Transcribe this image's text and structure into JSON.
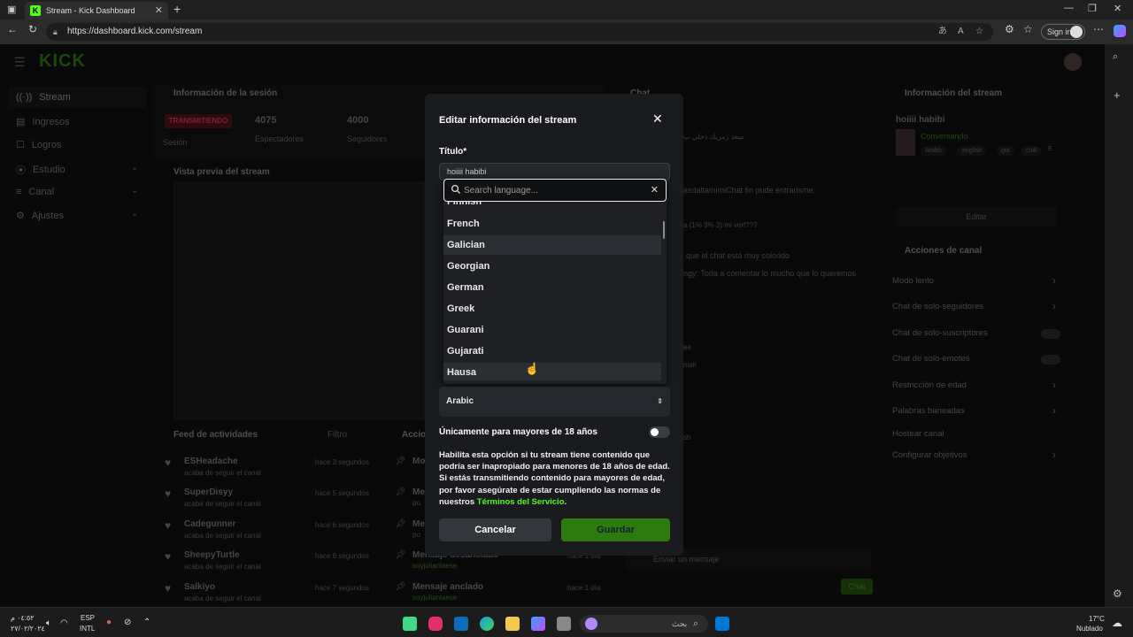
{
  "browser": {
    "tab_title": "Stream - Kick Dashboard",
    "url": "https://dashboard.kick.com/stream",
    "sign_in": "Sign in"
  },
  "sidebar": {
    "logo": "KICK",
    "items": [
      {
        "label": "Stream",
        "icon": "broadcast-icon"
      },
      {
        "label": "Ingresos",
        "icon": "wallet-icon"
      },
      {
        "label": "Logros",
        "icon": "trophy-icon"
      },
      {
        "label": "Estudio",
        "icon": "studio-icon"
      },
      {
        "label": "Canal",
        "icon": "channel-icon"
      },
      {
        "label": "Ajustes",
        "icon": "gear-icon"
      }
    ]
  },
  "session": {
    "title": "Información de la sesión",
    "status_badge": "TRANSMITIENDO",
    "status_label": "Sesión",
    "viewers": "4075",
    "viewers_label": "Espectadores",
    "followers": "4000",
    "followers_label": "Seguidores"
  },
  "preview": {
    "title": "Vista previa del stream"
  },
  "activity": {
    "title": "Feed de actividades",
    "filter": "Filtro",
    "items": [
      {
        "name": "ESHeadache",
        "sub": "acaba de seguir el canal",
        "time": "hace 3 segundos"
      },
      {
        "name": "SuperDisyy",
        "sub": "acaba de seguir el canal",
        "time": "hace 5 segundos"
      },
      {
        "name": "Cadegunner",
        "sub": "acaba de seguir el canal",
        "time": "hace 6 segundos"
      },
      {
        "name": "SheepyTurtle",
        "sub": "acaba de seguir el canal",
        "time": "hace 6 segundos"
      },
      {
        "name": "Salkiyo",
        "sub": "acaba de seguir el canal",
        "time": "hace 7 segundos"
      }
    ]
  },
  "actions_mini": {
    "title": "Accio",
    "items": [
      {
        "name": "Mo",
        "sub": ""
      },
      {
        "name": "Me",
        "sub": "po"
      },
      {
        "name": "Me",
        "sub": "po"
      },
      {
        "name": "Mensaje desanclado",
        "sub": "soyjulianlaese",
        "time": "hace 1 día"
      },
      {
        "name": "Mensaje anclado",
        "sub": "soyjulianlaese",
        "time": "hace 1 día"
      }
    ]
  },
  "chat": {
    "title": "Chat",
    "lines": [
      "سعد زمزبك دخلي ب",
      "asdaltamimiChat fin pude entrarisme:",
      "a (1% 3% 3) mi verf???",
      "que el chat está muy colorido",
      "ngy: Toda a comentar lo mucho que lo queremos",
      "nish",
      "ee",
      "sh"
    ],
    "placeholder": "Enviar un mensaje",
    "send": "Chat"
  },
  "stream_info": {
    "title": "Información del stream",
    "stream_title": "hoiiii habibi",
    "category": "Conversando",
    "tags": [
      "Arabic",
      "english",
      "gta",
      "chill",
      "E"
    ],
    "edit": "Editar"
  },
  "channel_actions": {
    "title": "Acciones de canal",
    "items": [
      {
        "label": "Modo lento",
        "control": "chevron"
      },
      {
        "label": "Chat de solo-seguidores",
        "control": "chevron"
      },
      {
        "label": "Chat de solo-suscriptores",
        "control": "toggle"
      },
      {
        "label": "Chat de solo-emotes",
        "control": "toggle"
      },
      {
        "label": "Restricción de edad",
        "control": "chevron"
      },
      {
        "label": "Palabras baneadas",
        "control": "chevron"
      },
      {
        "label": "Hostear canal",
        "control": "none"
      },
      {
        "label": "Configurar objetivos",
        "control": "chevron"
      }
    ]
  },
  "modal": {
    "title": "Editar información del stream",
    "titulo_label": "Título*",
    "titulo_value": "hoiiii habibi",
    "search_placeholder": "Search language...",
    "languages": [
      "Finnish",
      "French",
      "Galician",
      "Georgian",
      "German",
      "Greek",
      "Guarani",
      "Gujarati",
      "Hausa"
    ],
    "hovered_language": "Hausa",
    "highlighted_language": "Galician",
    "selected_language": "Arabic",
    "adult_label": "Únicamente para mayores de 18 años",
    "adult_enabled": false,
    "adult_desc": "Habilita esta opción si tu stream tiene contenido que podría ser inapropiado para menores de 18 años de edad. Si estás transmitiendo contenido para mayores de edad, por favor asegúrate de estar cumpliendo las normas de nuestros",
    "tos_link": "Términos del Servicio",
    "tos_end": ".",
    "cancel": "Cancelar",
    "save": "Guardar"
  },
  "taskbar": {
    "search_placeholder": "بحث",
    "lang_line1": "ESP",
    "lang_line2": "INTL",
    "clock_line1": "٠٤:٥٢ م",
    "clock_line2": "٢٧/٠٢/٢٠٢٤",
    "weather_temp": "17°C",
    "weather_text": "Nublado"
  },
  "colors": {
    "accent": "#53fc18",
    "badge": "#e2173b",
    "save_button": "#2f7a0e"
  }
}
